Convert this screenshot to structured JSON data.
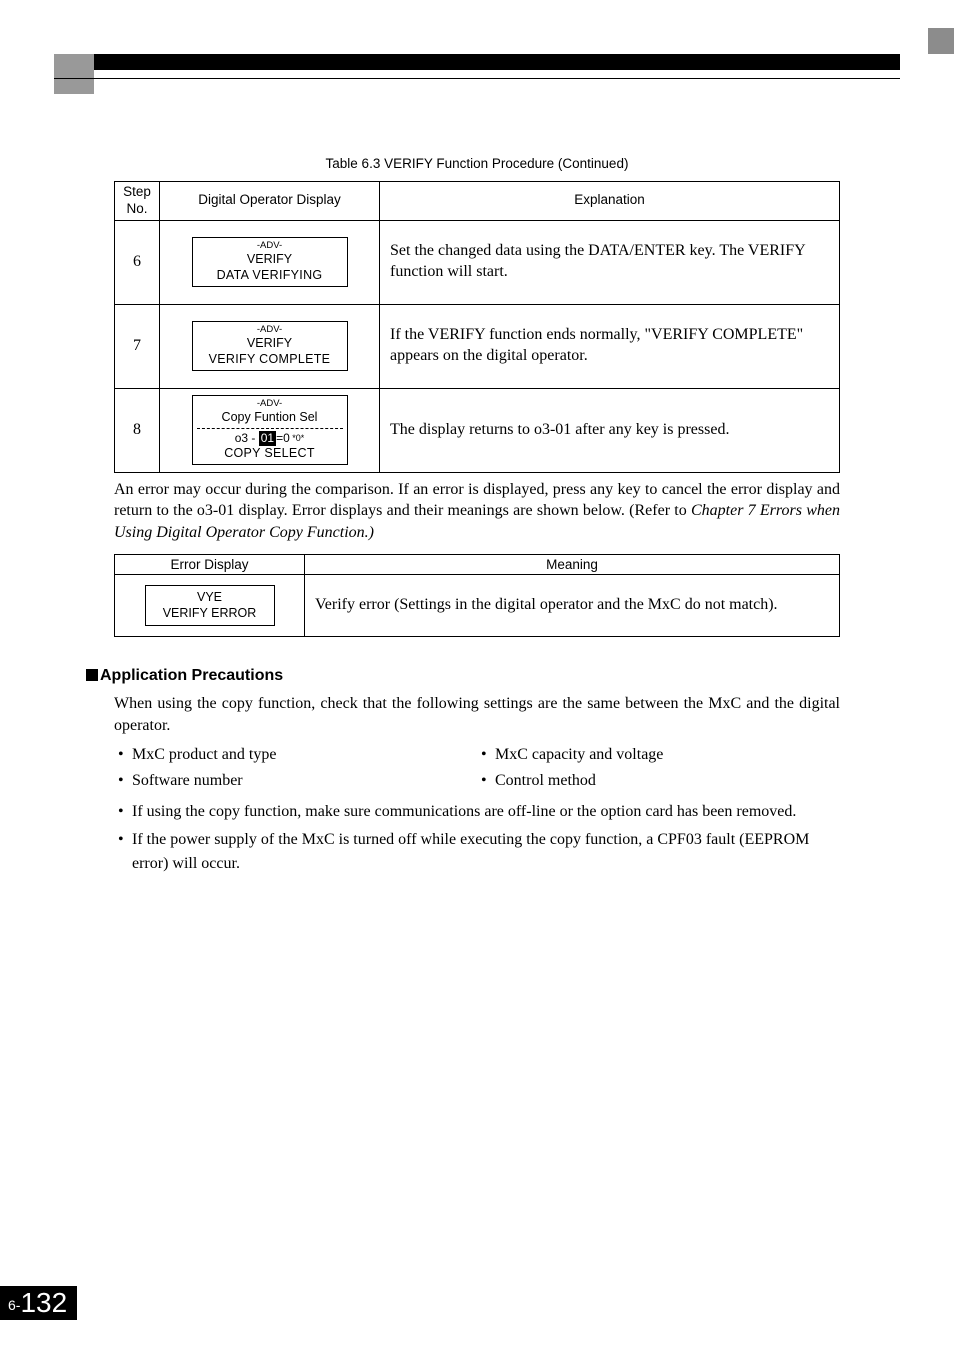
{
  "header": {},
  "table_caption": "Table 6.3   VERIFY Function Procedure (Continued)",
  "proc_table": {
    "head": {
      "step": "Step\nNo.",
      "display": "Digital Operator Display",
      "expl": "Explanation"
    },
    "rows": [
      {
        "no": "6",
        "lcd": {
          "l1": "-ADV-",
          "l2": "VERIFY",
          "l3": "DATA VERIFYING"
        },
        "expl": "Set the changed data using the DATA/ENTER key. The VERIFY function will start."
      },
      {
        "no": "7",
        "lcd": {
          "l1": "-ADV-",
          "l2": "VERIFY",
          "l3": "VERIFY  COMPLETE"
        },
        "expl": "If the VERIFY function ends normally, \"VERIFY COMPLETE\" appears on the digital operator."
      },
      {
        "no": "8",
        "lcd": {
          "l1": "-ADV-",
          "l2": "Copy Funtion Sel",
          "param_prefix": "o3 - ",
          "param_hl": "01",
          "param_suffix": "=0",
          "param_star": " *0*",
          "l4": "COPY SELECT"
        },
        "expl": "The display returns to o3-01 after any key is pressed."
      }
    ]
  },
  "note": {
    "text_a": "An error may occur during the comparison. If an error is displayed, press any key to cancel the error display and return to the o3-01 display. Error displays and their meanings are shown below. (Refer to ",
    "text_ital": "Chapter 7 Errors when Using Digital Operator Copy Function.)"
  },
  "err_table": {
    "head": {
      "disp": "Error Display",
      "mean": "Meaning"
    },
    "row": {
      "lcd": {
        "l1": "VYE",
        "l2": "VERIFY ERROR"
      },
      "mean": "Verify error (Settings in the digital operator and the MxC do not match)."
    }
  },
  "section": {
    "title": "Application Precautions",
    "para": "When using the copy function, check that the following settings are the same between the MxC and the digital operator.",
    "pairs": [
      "MxC product and type",
      "MxC capacity and voltage",
      "Software number",
      "Control method"
    ],
    "bullets": [
      "If using the copy function, make sure communications are off-line or the option card has been removed.",
      "If the power supply of the MxC is turned off while executing the copy function, a CPF03 fault (EEPROM error) will occur."
    ]
  },
  "footer": {
    "chapter": "6",
    "sep": "-",
    "page": "132"
  }
}
